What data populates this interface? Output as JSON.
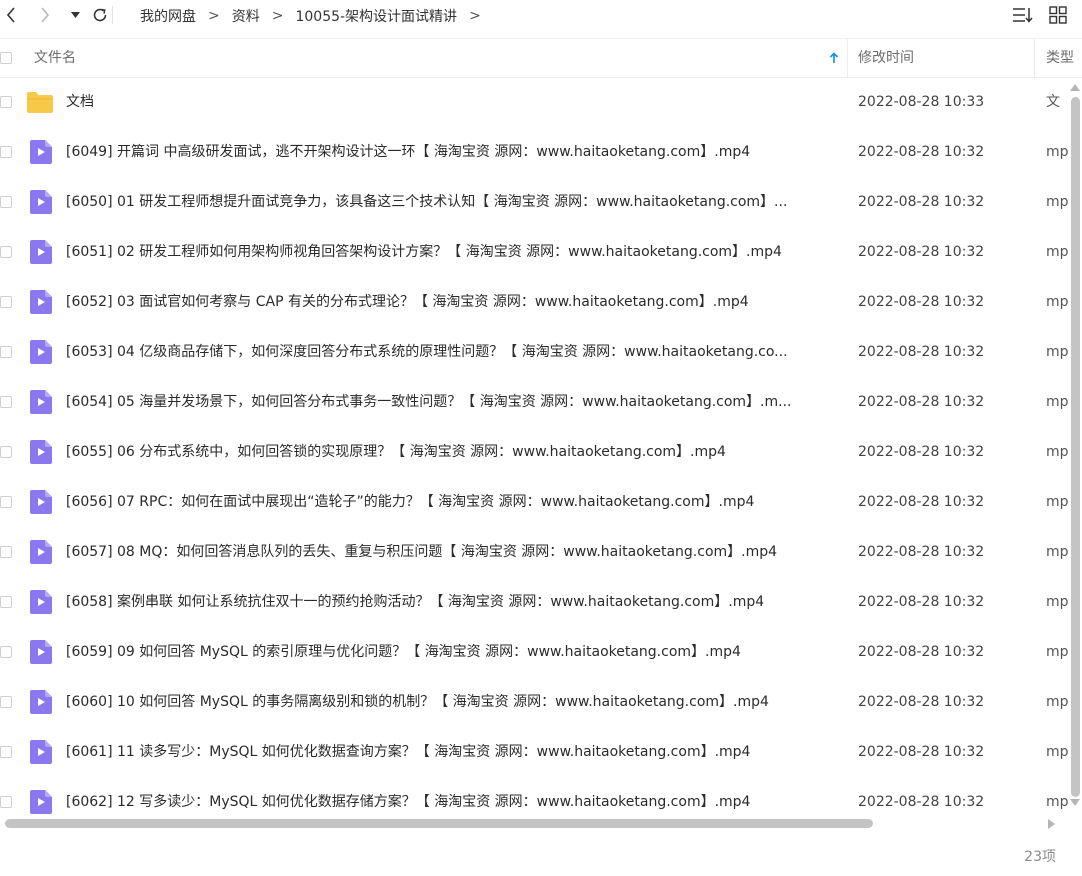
{
  "breadcrumb": [
    "我的网盘",
    "资料",
    "10055-架构设计面试精讲"
  ],
  "breadcrumb_separator": ">",
  "columns": {
    "name": "文件名",
    "mtime": "修改时间",
    "type": "类型"
  },
  "colors": {
    "accent": "#0a8ff0",
    "folder": "#f7c948",
    "video_icon": "#8b78ee"
  },
  "files": [
    {
      "icon": "folder-icon",
      "name": "文档",
      "mtime": "2022-08-28 10:33",
      "type": "文"
    },
    {
      "icon": "video-file-icon",
      "name": "[6049] 开篇词  中高级研发面试，逃不开架构设计这一环【 海淘宝资 源网：www.haitaoketang.com】.mp4",
      "mtime": "2022-08-28 10:32",
      "type": "mp"
    },
    {
      "icon": "video-file-icon",
      "name": "[6050] 01  研发工程师想提升面试竞争力，该具备这三个技术认知【 海淘宝资 源网：www.haitaoketang.com】...",
      "mtime": "2022-08-28 10:32",
      "type": "mp"
    },
    {
      "icon": "video-file-icon",
      "name": "[6051] 02  研发工程师如何用架构师视角回答架构设计方案？【 海淘宝资 源网：www.haitaoketang.com】.mp4",
      "mtime": "2022-08-28 10:32",
      "type": "mp"
    },
    {
      "icon": "video-file-icon",
      "name": "[6052] 03  面试官如何考察与 CAP 有关的分布式理论？【 海淘宝资 源网：www.haitaoketang.com】.mp4",
      "mtime": "2022-08-28 10:32",
      "type": "mp"
    },
    {
      "icon": "video-file-icon",
      "name": "[6053] 04  亿级商品存储下，如何深度回答分布式系统的原理性问题？【 海淘宝资 源网：www.haitaoketang.co...",
      "mtime": "2022-08-28 10:32",
      "type": "mp"
    },
    {
      "icon": "video-file-icon",
      "name": "[6054] 05  海量并发场景下，如何回答分布式事务一致性问题？【 海淘宝资 源网：www.haitaoketang.com】.m...",
      "mtime": "2022-08-28 10:32",
      "type": "mp"
    },
    {
      "icon": "video-file-icon",
      "name": "[6055] 06  分布式系统中，如何回答锁的实现原理？【 海淘宝资 源网：www.haitaoketang.com】.mp4",
      "mtime": "2022-08-28 10:32",
      "type": "mp"
    },
    {
      "icon": "video-file-icon",
      "name": "[6056] 07  RPC：如何在面试中展现出“造轮子”的能力？【 海淘宝资 源网：www.haitaoketang.com】.mp4",
      "mtime": "2022-08-28 10:32",
      "type": "mp"
    },
    {
      "icon": "video-file-icon",
      "name": "[6057] 08  MQ：如何回答消息队列的丢失、重复与积压问题【 海淘宝资 源网：www.haitaoketang.com】.mp4",
      "mtime": "2022-08-28 10:32",
      "type": "mp"
    },
    {
      "icon": "video-file-icon",
      "name": "[6058] 案例串联  如何让系统抗住双十一的预约抢购活动？【 海淘宝资 源网：www.haitaoketang.com】.mp4",
      "mtime": "2022-08-28 10:32",
      "type": "mp"
    },
    {
      "icon": "video-file-icon",
      "name": "[6059] 09  如何回答 MySQL 的索引原理与优化问题？【 海淘宝资 源网：www.haitaoketang.com】.mp4",
      "mtime": "2022-08-28 10:32",
      "type": "mp"
    },
    {
      "icon": "video-file-icon",
      "name": "[6060] 10  如何回答 MySQL 的事务隔离级别和锁的机制？【 海淘宝资 源网：www.haitaoketang.com】.mp4",
      "mtime": "2022-08-28 10:32",
      "type": "mp"
    },
    {
      "icon": "video-file-icon",
      "name": "[6061] 11  读多写少：MySQL 如何优化数据查询方案？【 海淘宝资 源网：www.haitaoketang.com】.mp4",
      "mtime": "2022-08-28 10:32",
      "type": "mp"
    },
    {
      "icon": "video-file-icon",
      "name": "[6062] 12  写多读少：MySQL 如何优化数据存储方案？【 海淘宝资 源网：www.haitaoketang.com】.mp4",
      "mtime": "2022-08-28 10:32",
      "type": "mp"
    }
  ],
  "status": {
    "count": "23项"
  }
}
